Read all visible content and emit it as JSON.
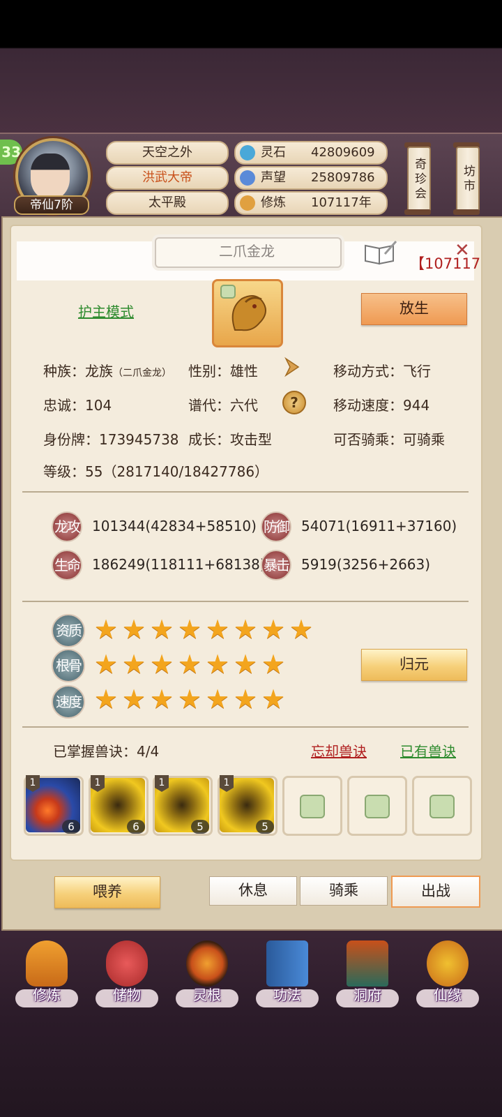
{
  "player": {
    "level_badge": "33",
    "rank": "帝仙7阶",
    "titles": [
      "天空之外",
      "洪武大帝",
      "太平殿"
    ],
    "resources": [
      {
        "label": "灵石",
        "value": "42809609",
        "icon": "spirit-stone-icon",
        "color": "#4aa8d8"
      },
      {
        "label": "声望",
        "value": "25809786",
        "icon": "prestige-icon",
        "color": "#5a8ad8"
      },
      {
        "label": "修炼",
        "value": "107117年",
        "icon": "meditation-icon",
        "color": "#e0a040"
      }
    ]
  },
  "side_buttons": {
    "treasure": "奇珍会",
    "market": "坊市"
  },
  "pet": {
    "name": "二爪金龙",
    "id_tag": "【107117",
    "mode": "护主模式",
    "release": "放生",
    "info": {
      "race": "种族：龙族",
      "race_sub": "（二爪金龙）",
      "gender": "性别：雄性",
      "move_type": "移动方式：飞行",
      "loyalty": "忠诚：104",
      "generation": "谱代：六代",
      "move_speed": "移动速度：944",
      "id_card": "身份牌：173945738",
      "growth": "成长：攻击型",
      "rideable": "可否骑乘：可骑乘",
      "level": "等级：55（2817140/18427786）"
    },
    "stats": [
      {
        "icon": "龙攻",
        "value": "101344(42834+58510)"
      },
      {
        "icon": "防御",
        "value": "54071(16911+37160)"
      },
      {
        "icon": "生命",
        "value": "186249(118111+68138)"
      },
      {
        "icon": "暴击",
        "value": "5919(3256+2663)"
      }
    ],
    "qualities": [
      {
        "label": "资质",
        "stars": 8
      },
      {
        "label": "根骨",
        "stars": 7
      },
      {
        "label": "速度",
        "stars": 7
      }
    ],
    "reset": "归元",
    "skills": {
      "mastered": "已掌握兽诀：4/4",
      "forget": "忘却兽诀",
      "owned": "已有兽诀",
      "slots": [
        {
          "tier": "1",
          "level": "6",
          "type": "ice-fire"
        },
        {
          "tier": "1",
          "level": "6",
          "type": "golden-beast"
        },
        {
          "tier": "1",
          "level": "5",
          "type": "golden-beast"
        },
        {
          "tier": "1",
          "level": "5",
          "type": "golden-beast"
        }
      ],
      "locked_count": 3
    },
    "actions": {
      "feed": "喂养",
      "rest": "休息",
      "ride": "骑乘",
      "battle": "出战"
    }
  },
  "nav": [
    "修炼",
    "储物",
    "灵根",
    "功法",
    "洞府",
    "仙缘"
  ]
}
